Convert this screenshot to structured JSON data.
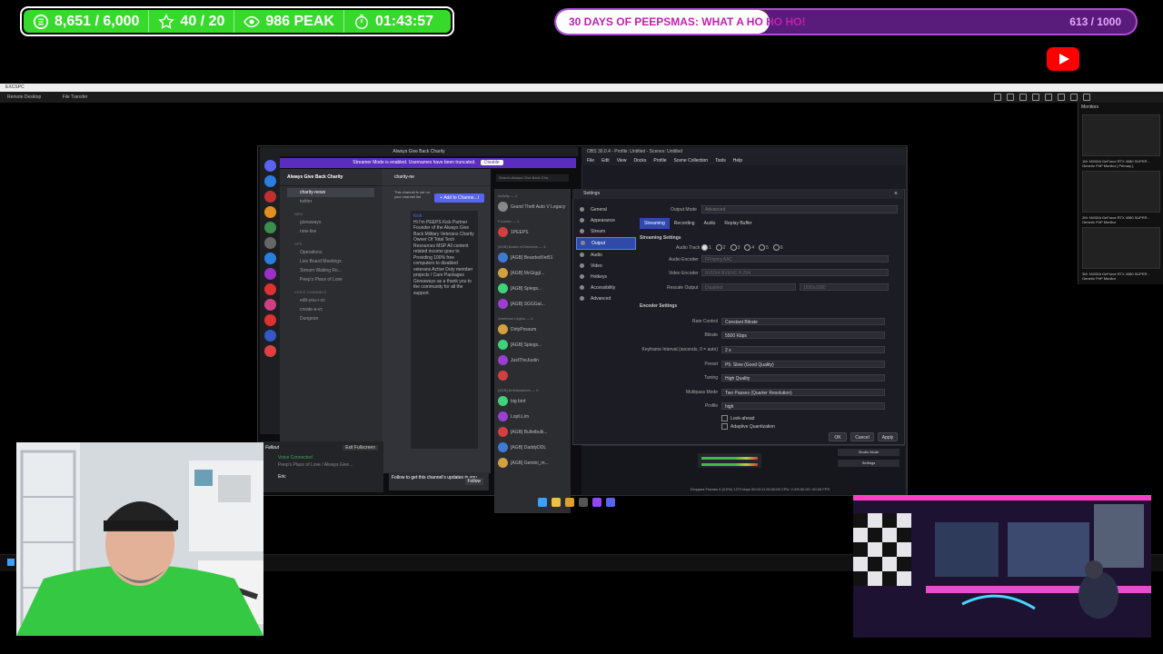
{
  "stats": {
    "followers": "8,651 / 6,000",
    "stars": "40 / 20",
    "viewers": "986 PEAK",
    "timer": "01:43:57"
  },
  "goal": {
    "title": "30 DAYS OF PEEPSMAS: WHAT A HO HO HO!",
    "count": "613 / 1000",
    "progress": 0.613
  },
  "remote": {
    "title": "EXCSPC",
    "tabs": [
      "Remote Desktop",
      "File Transfer"
    ],
    "monitors_title": "Monitors",
    "monitors": [
      "1M: NVIDIA GeForce RTX 4080 SUPER - Generic PnP Monitor [ Primary ]",
      "2M: NVIDIA GeForce RTX 4080 SUPER - Generic PnP Monitor",
      "3M: NVIDIA GeForce RTX 4080 SUPER - Generic PnP Monitor"
    ]
  },
  "discord": {
    "window_title": "Always Give Back Charity",
    "banner": "Streamer Mode is enabled. Usernames have been truncated.",
    "banner_button": "Disable",
    "server_name": "Always Give Back Charity",
    "channels": [
      {
        "type": "channel",
        "label": "charity-news",
        "selected": true
      },
      {
        "type": "channel",
        "label": "twitter"
      },
      {
        "type": "category",
        "label": "NEW"
      },
      {
        "type": "channel",
        "label": "giveaways"
      },
      {
        "type": "channel",
        "label": "now-live"
      },
      {
        "type": "category",
        "label": "OPS"
      },
      {
        "type": "channel",
        "label": "Operations"
      },
      {
        "type": "channel",
        "label": "Live Board Meetings"
      },
      {
        "type": "channel",
        "label": "Stream Waiting Ro..."
      },
      {
        "type": "channel",
        "label": "Peep's Place of Love"
      },
      {
        "type": "category",
        "label": "VOICE CHANNELS"
      },
      {
        "type": "channel",
        "label": "edit-you-r-vc"
      },
      {
        "type": "channel",
        "label": "create-a-vc"
      },
      {
        "type": "channel",
        "label": "Dungeon"
      }
    ],
    "chat_channel": "charity-ne",
    "search_placeholder": "Search Always Give Back Cha",
    "add_channel": "+ Add to Channe...l",
    "notice": "This channel is not on your channel list",
    "bio_name": "Kick",
    "bio_text": "Hi I'm PEEPS Kick Partner Founder of the Always Give Back Military Veterans Charity Owner Of Total Tech Resources MSP All content related income goes to Providing 100% free computers to disabled veterans Active Duty member projects / Care Packages Giveaways as a thank you to the community for all the support.",
    "follow_text": "Follow to get this channel's updates in you...",
    "follow_button": "Follow",
    "voice_status": "Voice Connected",
    "voice_channel": "Peep's Place of Love / Always Give...",
    "username": "Eric",
    "activity": "Activity — 1",
    "game_status": "Grand Theft Auto V Legacy",
    "member_groups": [
      {
        "label": "Founder — 1",
        "members": [
          "1PEEPS"
        ]
      },
      {
        "label": "[AGB] Board of Directors — 4",
        "members": [
          "[AGB] BeardedVet51",
          "[AGB] McGiggl...",
          "[AGB] Spiegs...",
          "[AGB] SGGGal..."
        ]
      },
      {
        "label": "American Legion — 4",
        "members": [
          "DirtyPossum",
          "[AGB] Spiegs...",
          "JustTheJustin",
          ""
        ]
      },
      {
        "label": "[AGB] Ambassadors — 0",
        "members": [
          "big bird",
          "Lopli.Lim",
          "[AGB] Bulletbulk...",
          "[AGB] DaddyDDL",
          "[AGB] Gemini_m..."
        ]
      }
    ],
    "fallout_label": "Fallout",
    "fallout_button": "Exit Fullscreen"
  },
  "obs": {
    "title": "OBS 30.0.4 - Profile: Untitled - Scenes: Untitled",
    "menu": [
      "File",
      "Edit",
      "View",
      "Docks",
      "Profile",
      "Scene Collection",
      "Tools",
      "Help"
    ],
    "settings_title": "Settings",
    "nav": [
      "General",
      "Appearance",
      "Stream",
      "Output",
      "Audio",
      "Video",
      "Hotkeys",
      "Accessibility",
      "Advanced"
    ],
    "active_nav": "Output",
    "output_mode_label": "Output Mode",
    "output_mode_value": "Advanced",
    "tabs": [
      "Streaming",
      "Recording",
      "Audio",
      "Replay Buffer"
    ],
    "streaming_settings": "Streaming Settings",
    "audio_track_label": "Audio Track",
    "audio_tracks": [
      "1",
      "2",
      "3",
      "4",
      "5",
      "6"
    ],
    "audio_encoder_label": "Audio Encoder",
    "audio_encoder_value": "FFmpeg AAC",
    "video_encoder_label": "Video Encoder",
    "video_encoder_value": "NVIDIA NVENC H.264",
    "rescale_label": "Rescale Output",
    "rescale_value": "Disabled",
    "rescale_res": "1920x1080",
    "encoder_settings": "Encoder Settings",
    "fields": [
      {
        "label": "Rate Control",
        "value": "Constant Bitrate"
      },
      {
        "label": "Bitrate",
        "value": "5500 Kbps"
      },
      {
        "label": "Keyframe Interval (seconds, 0 = auto)",
        "value": "2 s"
      },
      {
        "label": "Preset",
        "value": "P5: Slow (Good Quality)"
      },
      {
        "label": "Tuning",
        "value": "High Quality"
      },
      {
        "label": "Multipass Mode",
        "value": "Two Passes (Quarter Resolution)"
      },
      {
        "label": "Profile",
        "value": "high"
      }
    ],
    "lookahead": "Look-ahead",
    "adaptive": "Adaptive Quantization",
    "ok": "OK",
    "cancel": "Cancel",
    "apply": "Apply",
    "studio_mode": "Studio Mode",
    "settings_button": "Settings",
    "status": "Dropped Frames 0 (0.0%)   1272 kbps   00:03:11   00:00:00   CPU: 2.4%   60.00 / 60.00 FPS"
  },
  "colors": {
    "stats_green": "#38d92d",
    "goal_purple": "#b44ad9",
    "goal_text": "#c01fb0",
    "obs_active": "#2f4aa8",
    "discord_blurple": "#5865f2"
  }
}
